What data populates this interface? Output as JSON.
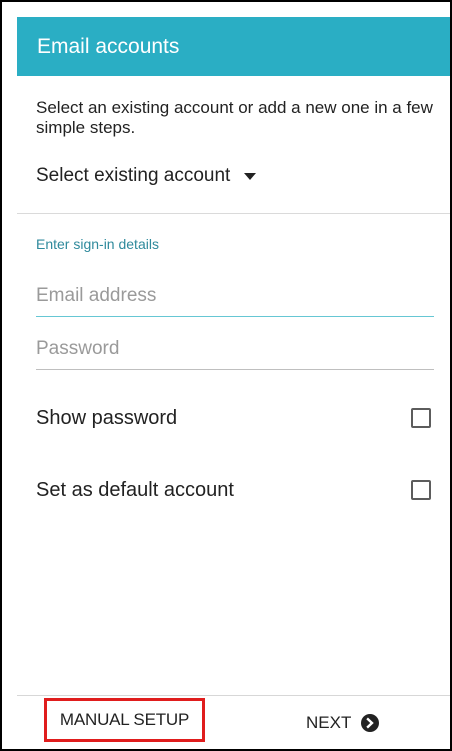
{
  "header": {
    "title": "Email accounts"
  },
  "intro": {
    "description": "Select an existing account or add a new one in a few simple steps.",
    "account_select_label": "Select existing account",
    "account_select_icon": "dropdown-arrow-icon"
  },
  "sign_in": {
    "section_label": "Enter sign-in details",
    "email_placeholder": "Email address",
    "email_value": "",
    "password_placeholder": "Password",
    "password_value": ""
  },
  "options": {
    "show_password_label": "Show password",
    "show_password_checked": false,
    "default_account_label": "Set as default account",
    "default_account_checked": false
  },
  "footer": {
    "manual_setup_label": "MANUAL SETUP",
    "next_label": "NEXT",
    "next_icon": "chevron-right-circle-icon"
  },
  "colors": {
    "header_background": "#2aaec4",
    "accent_teal": "#2f8a9c",
    "highlight_border": "#e01d1d"
  }
}
